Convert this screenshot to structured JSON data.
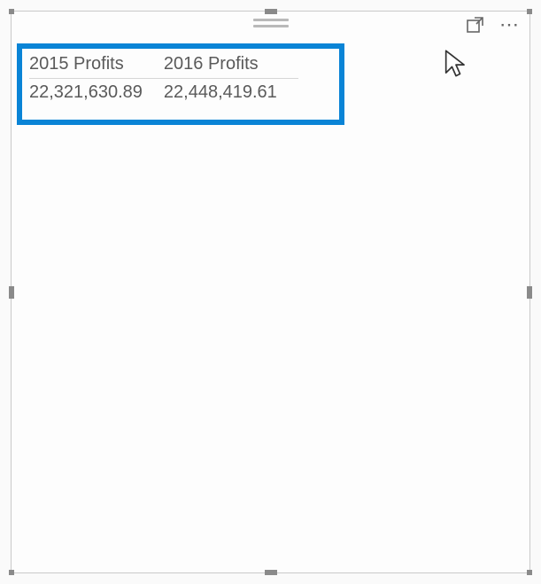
{
  "table": {
    "columns": [
      "2015 Profits",
      "2016 Profits"
    ],
    "rows": [
      [
        "22,321,630.89",
        "22,448,419.61"
      ]
    ]
  },
  "icons": {
    "focus_mode": "focus-mode",
    "more": "⋯"
  }
}
